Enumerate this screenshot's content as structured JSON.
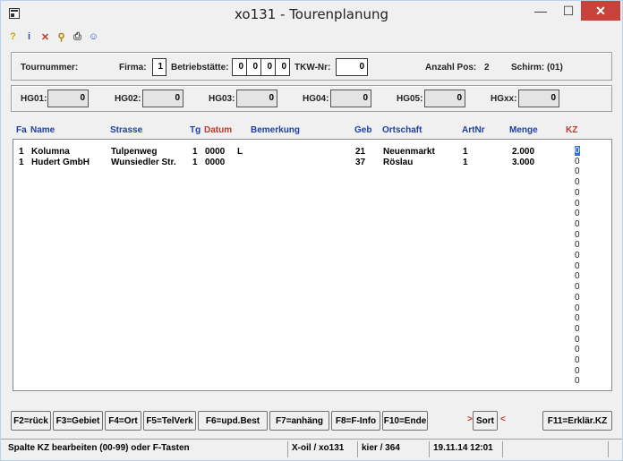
{
  "window": {
    "title": "xo131 - Tourenplanung",
    "min": "—",
    "max": "☐",
    "close": "✕"
  },
  "header": {
    "tournummer_label": "Tournummer:",
    "firma_label": "Firma:",
    "firma_value": "1",
    "betriebsstaette_label": "Betriebstätte:",
    "betriebsstaette_values": [
      "0",
      "0",
      "0",
      "0"
    ],
    "tkw_label": "TKW-Nr:",
    "tkw_value": "0",
    "anzahl_label": "Anzahl Pos:",
    "anzahl_value": "2",
    "schirm_label": "Schirm: (01)"
  },
  "hg": [
    {
      "label": "HG01:",
      "value": "0"
    },
    {
      "label": "HG02:",
      "value": "0"
    },
    {
      "label": "HG03:",
      "value": "0"
    },
    {
      "label": "HG04:",
      "value": "0"
    },
    {
      "label": "HG05:",
      "value": "0"
    },
    {
      "label": "HGxx:",
      "value": "0"
    }
  ],
  "columns": {
    "fa": "Fa",
    "name": "Name",
    "strasse": "Strasse",
    "tg": "Tg",
    "datum": "Datum",
    "bemerkung": "Bemerkung",
    "geb": "Geb",
    "ortschaft": "Ortschaft",
    "artnr": "ArtNr",
    "menge": "Menge",
    "kz": "KZ"
  },
  "rows": [
    {
      "fa": "1",
      "name": "Kolumna",
      "strasse": "Tulpenweg",
      "tg": "1",
      "datum": "0000",
      "bemerkung": "L",
      "geb": "21",
      "ortschaft": "Neuenmarkt",
      "artnr": "1",
      "menge": "2.000"
    },
    {
      "fa": "1",
      "name": "Hudert GmbH",
      "strasse": "Wunsiedler Str.",
      "tg": "1",
      "datum": "0000",
      "bemerkung": "",
      "geb": "37",
      "ortschaft": "Röslau",
      "artnr": "1",
      "menge": "3.000"
    }
  ],
  "kz_values": [
    "0",
    "0",
    "0",
    "0",
    "0",
    "0",
    "0",
    "0",
    "0",
    "0",
    "0",
    "0",
    "0",
    "0",
    "0",
    "0",
    "0",
    "0",
    "0",
    "0",
    "0",
    "0",
    "0"
  ],
  "fkeys": {
    "f2": "F2=rück",
    "f3": "F3=Gebiet",
    "f4": "F4=Ort",
    "f5": "F5=TelVerk",
    "f6": "F6=upd.Best",
    "f7": "F7=anhäng",
    "f8": "F8=F-Info",
    "f10": "F10=Ende",
    "sort": "Sort",
    "sort_left": ">",
    "sort_right": "<",
    "f11": "F11=Erklär.KZ"
  },
  "status": {
    "hint": "Spalte KZ bearbeiten (00-99) oder F-Tasten",
    "program": "X-oil / xo131",
    "user": "kier / 364",
    "datetime": "19.11.14 12:01"
  },
  "colors": {
    "header_blue": "#1f3fa8",
    "header_red": "#c0392b",
    "close_red": "#c7423b"
  },
  "icons": [
    "app-icon",
    "help-icon",
    "info-icon",
    "delete-icon",
    "search-icon",
    "print-icon",
    "user-icon"
  ]
}
